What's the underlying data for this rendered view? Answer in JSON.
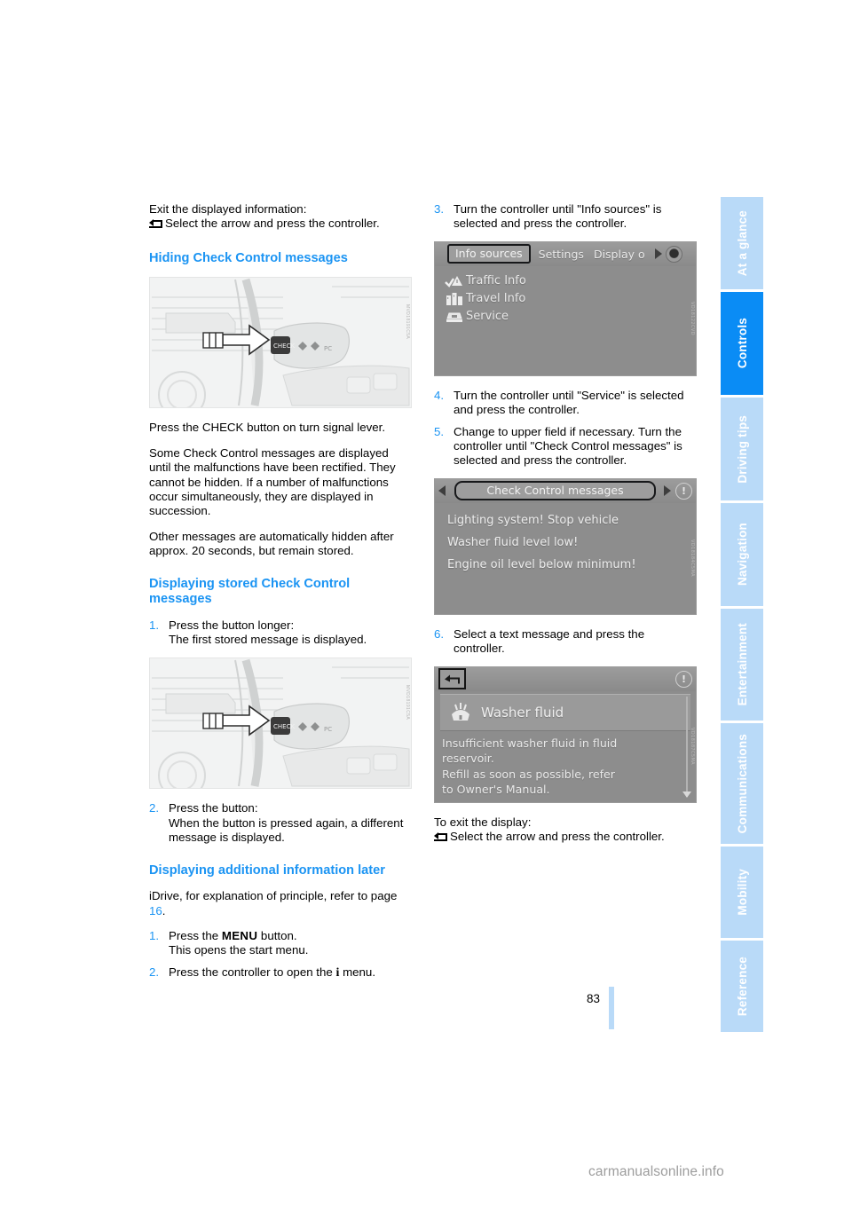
{
  "page": {
    "number": "83",
    "watermark": "carmanualsonline.info"
  },
  "side_tabs": [
    {
      "label": "At a glance",
      "active": false
    },
    {
      "label": "Controls",
      "active": true
    },
    {
      "label": "Driving tips",
      "active": false
    },
    {
      "label": "Navigation",
      "active": false
    },
    {
      "label": "Entertainment",
      "active": false
    },
    {
      "label": "Communications",
      "active": false
    },
    {
      "label": "Mobility",
      "active": false
    },
    {
      "label": "Reference",
      "active": false
    }
  ],
  "left_column": {
    "intro_line": "Exit the displayed information:",
    "intro_arrow_line": "Select the arrow and press the controller.",
    "heading_hiding": "Hiding Check Control messages",
    "photo1_caption_code": "MVD18191C5A",
    "para_press_check": "Press the CHECK button on turn signal lever.",
    "para_some_messages": "Some Check Control messages are displayed until the malfunctions have been rectified. They cannot be hidden. If a number of malfunctions occur simultaneously, they are displayed in succession.",
    "para_other_messages": "Other messages are automatically hidden after approx. 20 seconds, but remain stored.",
    "heading_displaying_stored": "Displaying stored Check Control messages",
    "step1_num": "1.",
    "step1_line1": "Press the button longer:",
    "step1_line2": "The first stored message is displayed.",
    "photo2_caption_code": "MVD18191C5A",
    "step2_num": "2.",
    "step2_line1": "Press the button:",
    "step2_line2": "When the button is pressed again, a different message is displayed.",
    "heading_additional_info": "Displaying additional information later",
    "para_idrive_prefix": "iDrive, for explanation of principle, refer to page ",
    "para_idrive_pagelink": "16",
    "para_idrive_suffix": ".",
    "step_menu_num": "1.",
    "step_menu_pre": "Press the ",
    "step_menu_key": "MENU",
    "step_menu_post": " button.",
    "step_menu_line2": "This opens the start menu.",
    "step_controller_num": "2.",
    "step_controller_pre": "Press the controller to open the ",
    "step_controller_key": "i",
    "step_controller_post": " menu."
  },
  "right_column": {
    "step3_num": "3.",
    "step3_text": "Turn the controller until \"Info sources\" is selected and press the controller.",
    "screen_info_sources": {
      "caption_code": "VD18122CVD",
      "selected_tab": "Info sources",
      "tabs": [
        "Settings",
        "Display o"
      ],
      "items": [
        {
          "label": "Traffic Info",
          "icon": "traffic-warning-icon"
        },
        {
          "label": "Travel Info",
          "icon": "travel-info-icon"
        },
        {
          "label": "Service",
          "icon": "service-icon"
        }
      ]
    },
    "step4_num": "4.",
    "step4_text": "Turn the controller until \"Service\" is selected and press the controller.",
    "step5_num": "5.",
    "step5_text": "Change to upper field if necessary. Turn the controller until \"Check Control messages\" is selected and press the controller.",
    "screen_check_control": {
      "caption_code": "VD18184C5MA",
      "title": "Check Control messages",
      "messages": [
        "Lighting system! Stop vehicle",
        "Washer fluid level low!",
        "Engine oil level below minimum!"
      ],
      "info_icon": "info-circle-icon"
    },
    "step6_num": "6.",
    "step6_text": "Select a text message and press the controller.",
    "screen_washer_fluid": {
      "caption_code": "VD18187C5MA",
      "back_icon": "back-arrow-icon",
      "info_icon": "info-circle-icon",
      "item_icon": "washer-fluid-icon",
      "item_title": "Washer fluid",
      "body_lines": [
        "Insufficient washer fluid in fluid",
        "reservoir.",
        "Refill as soon as possible, refer",
        "to Owner's Manual."
      ],
      "scroll_icon": "chevron-down-icon"
    },
    "exit_line": "To exit the display:",
    "exit_arrow_line": "Select the arrow and press the controller."
  },
  "colors": {
    "accent_blue": "#1b94f3",
    "tab_active": "#0a8cf5",
    "tab_inactive": "#b9daf8",
    "screen_grey": "#8d8d8d"
  }
}
